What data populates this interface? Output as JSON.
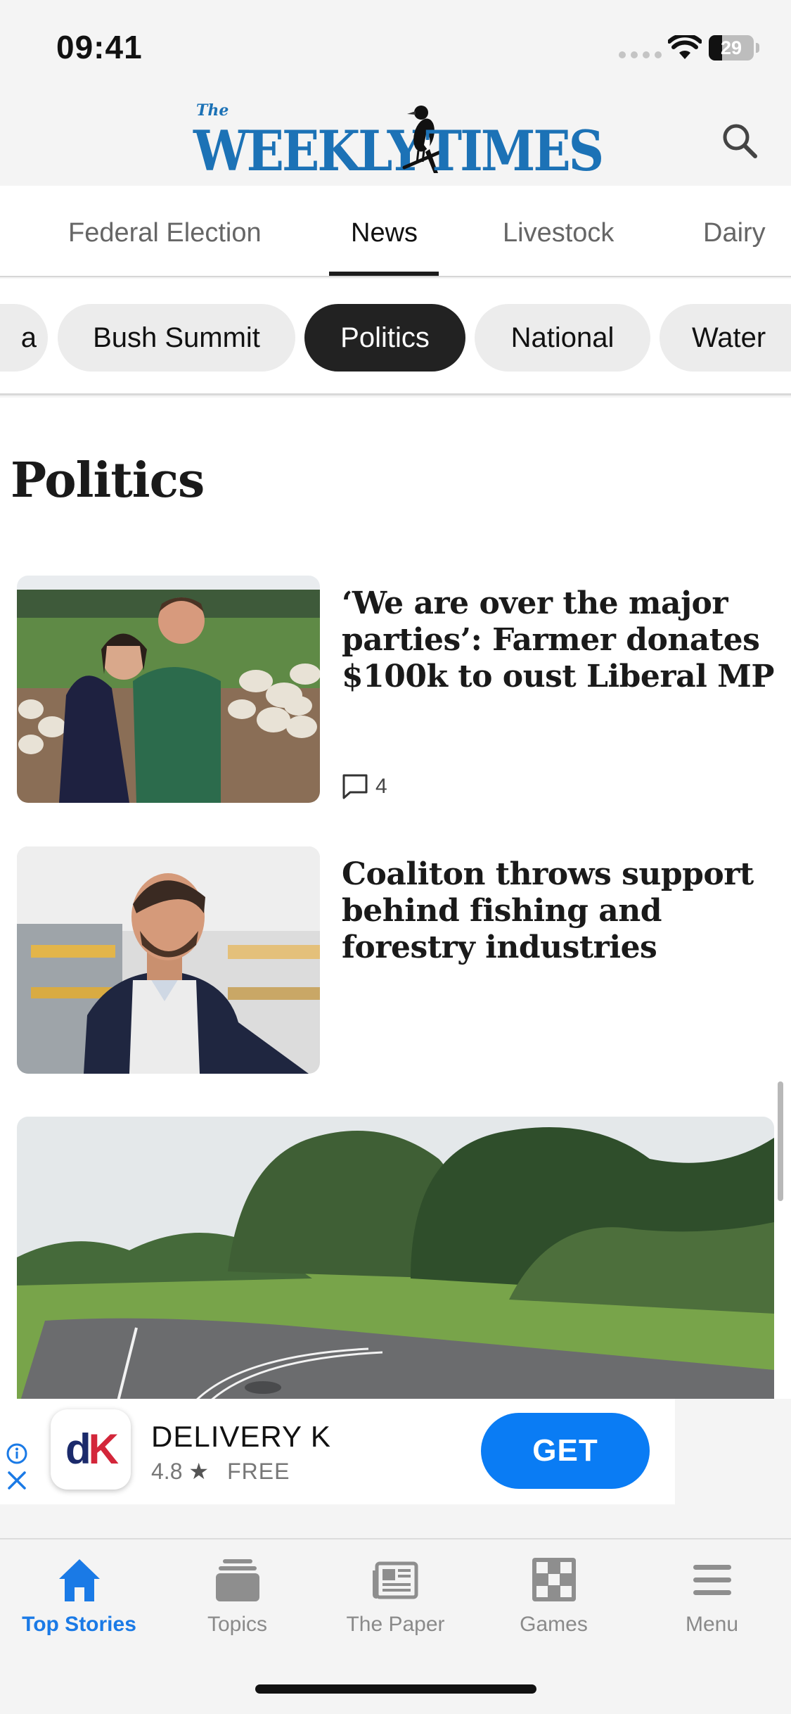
{
  "status_bar": {
    "time": "09:41",
    "battery_level": "29",
    "battery_fraction": 0.29
  },
  "header": {
    "logo_the": "The",
    "logo_weekly": "WEEKLY",
    "logo_times": "TIMES",
    "search_icon": "search-icon"
  },
  "section_tabs": [
    {
      "label": "Federal Election",
      "active": false
    },
    {
      "label": "News",
      "active": true
    },
    {
      "label": "Livestock",
      "active": false
    },
    {
      "label": "Dairy",
      "active": false
    }
  ],
  "chips": [
    {
      "label": "a",
      "active": false
    },
    {
      "label": "Bush Summit",
      "active": false
    },
    {
      "label": "Politics",
      "active": true
    },
    {
      "label": "National",
      "active": false
    },
    {
      "label": "Water",
      "active": false
    }
  ],
  "section_heading": "Politics",
  "articles": [
    {
      "headline": "‘We are over the major parties’: Farmer donates $100k to oust Liberal MP",
      "comment_count": "4",
      "image": "photo of a couple standing in front of a flock of sheep"
    },
    {
      "headline": "Coaliton throws support behind fishing and forestry industries",
      "image": "photo of a smiling man in a navy jacket"
    }
  ],
  "ad": {
    "app_name": "DELIVERY K",
    "rating": "4.8",
    "price": "FREE",
    "cta": "GET",
    "icon_text_d": "d",
    "icon_text_k": "K"
  },
  "bottom_nav": [
    {
      "label": "Top Stories",
      "icon": "home-icon",
      "active": true
    },
    {
      "label": "Topics",
      "icon": "topics-icon",
      "active": false
    },
    {
      "label": "The Paper",
      "icon": "newspaper-icon",
      "active": false
    },
    {
      "label": "Games",
      "icon": "games-icon",
      "active": false
    },
    {
      "label": "Menu",
      "icon": "menu-icon",
      "active": false
    }
  ],
  "colors": {
    "brand_blue": "#1c72b6",
    "active_nav_blue": "#1a7ae6",
    "get_button_blue": "#0a7cf4",
    "active_chip": "#222222"
  }
}
